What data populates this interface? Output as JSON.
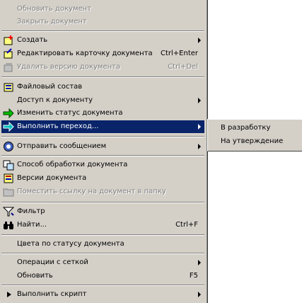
{
  "menu": {
    "items": [
      {
        "label": "Обновить документ"
      },
      {
        "label": "Закрыть документ"
      },
      {
        "label": "Создать"
      },
      {
        "label": "Редактировать карточку документа",
        "shortcut": "Ctrl+Enter"
      },
      {
        "label": "Удалить версию документа",
        "shortcut": "Ctrl+Del"
      },
      {
        "label": "Файловый состав"
      },
      {
        "label": "Доступ к документу"
      },
      {
        "label": "Изменить статус документа"
      },
      {
        "label": "Выполнить переход..."
      },
      {
        "label": "Отправить сообщением"
      },
      {
        "label": "Способ обработки документа"
      },
      {
        "label": "Версии документа"
      },
      {
        "label": "Поместить ссылку на документ в папку"
      },
      {
        "label": "Фильтр"
      },
      {
        "label": "Найти...",
        "shortcut": "Ctrl+F"
      },
      {
        "label": "Цвета по статусу документа"
      },
      {
        "label": "Операции с сеткой"
      },
      {
        "label": "Обновить",
        "shortcut": "F5"
      },
      {
        "label": "Выполнить скрипт"
      }
    ]
  },
  "submenu": {
    "items": [
      {
        "label": "В разработку"
      },
      {
        "label": "На утверждение"
      }
    ]
  },
  "icons": {
    "create": "new-document-icon",
    "edit": "edit-card-icon",
    "delete": "delete-version-icon",
    "files": "file-composition-icon",
    "status": "green-arrow-icon",
    "transition": "transition-arrow-icon",
    "send": "send-message-icon",
    "processing": "processing-method-icon",
    "versions": "versions-icon",
    "link": "folder-link-icon",
    "filter": "filter-icon",
    "find": "binoculars-icon",
    "script": "run-script-icon"
  },
  "colors": {
    "menu_bg": "#d4d0c8",
    "highlight": "#0a246a",
    "disabled": "#808080"
  }
}
